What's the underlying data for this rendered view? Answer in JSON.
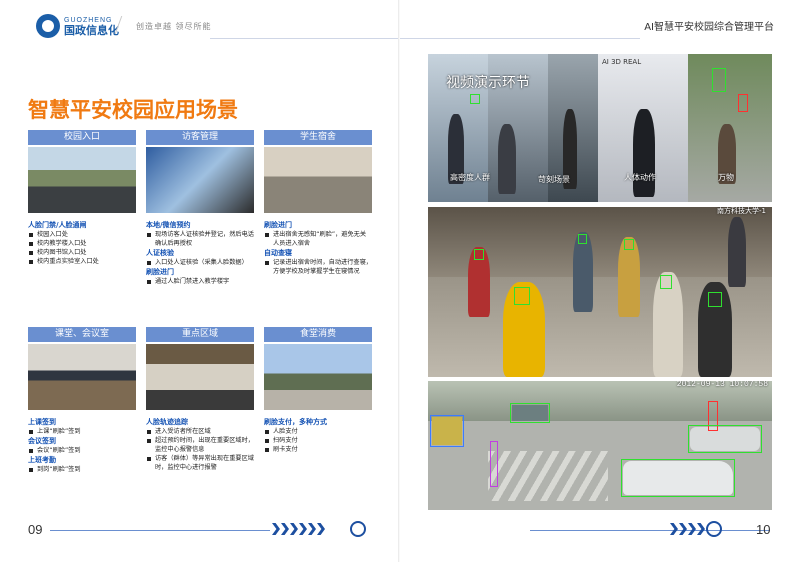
{
  "left_page": {
    "brand_en": "GUOZHENG",
    "brand_cn": "国政信息化",
    "slogan": "创造卓越  领尽所能",
    "title": "智慧平安校园应用场景",
    "page_number": "09",
    "cards": [
      {
        "header": "校园入口",
        "sections": [
          {
            "heading": "人脸门禁/人脸通闸",
            "items": [
              "校园入口处",
              "校内教学楼入口处",
              "校内图书馆入口处",
              "校内重点实验室入口处"
            ]
          }
        ]
      },
      {
        "header": "访客管理",
        "sections": [
          {
            "heading": "本地/微信预约",
            "items": [
              "现场访客人证核验并登记，然后电话确认后再授权"
            ]
          },
          {
            "heading": "人证核验",
            "items": [
              "入口处人证核验（采集人脸数据）"
            ]
          },
          {
            "heading": "刷脸进门",
            "items": [
              "通过人脸门禁进入教学楼字"
            ]
          }
        ]
      },
      {
        "header": "学生宿舍",
        "sections": [
          {
            "heading": "刷脸进门",
            "items": [
              "进出宿舍无感知“刷脸”，避免无关人员进入宿舍"
            ]
          },
          {
            "heading": "自动查寝",
            "items": [
              "记录进出宿舍时间，自动进行查寝，方便学校及时掌握学生在寝情况"
            ]
          }
        ]
      },
      {
        "header": "课堂、会议室",
        "sections": [
          {
            "heading": "上课签到",
            "items": [
              "上课“刷脸”签到"
            ]
          },
          {
            "heading": "会议签到",
            "items": [
              "会议“刷脸”签到"
            ]
          },
          {
            "heading": "上班考勤",
            "items": [
              "到岗“刷脸”签到"
            ]
          }
        ]
      },
      {
        "header": "重点区域",
        "sections": [
          {
            "heading": "人脸轨迹追踪",
            "items": [
              "进入受访者所在区域",
              "超过预约时间，出现在重要区域时，监控中心报警信息",
              "访客（群体）等异常出现在重要区域时，监控中心进行报警"
            ]
          }
        ]
      },
      {
        "header": "食堂消费",
        "sections": [
          {
            "heading": "刷脸支付，多种方式",
            "items": [
              "人脸支付",
              "扫码支付",
              "刷卡支付"
            ]
          }
        ]
      }
    ]
  },
  "right_page": {
    "header_title": "AI智慧平安校园综合管理平台",
    "page_number": "10",
    "video1": {
      "overlay_title": "视频演示环节",
      "labels": [
        "高密度人群",
        "苛刻场景",
        "人体动作",
        "万物"
      ],
      "sign_text": "AI 3D REAL"
    },
    "video2": {
      "caption": "南方科技大学-1"
    },
    "video3": {
      "timestamp": "2012-09-13 10:07:58"
    }
  },
  "colors": {
    "accent_orange": "#f07a12",
    "card_header_blue": "#6a8fd0",
    "section_blue": "#1553b4",
    "brand_blue": "#1b5ea8"
  },
  "icons": [
    "logo-mark-icon",
    "chevron-right-icon",
    "emblem-icon",
    "bullet-square-icon"
  ]
}
